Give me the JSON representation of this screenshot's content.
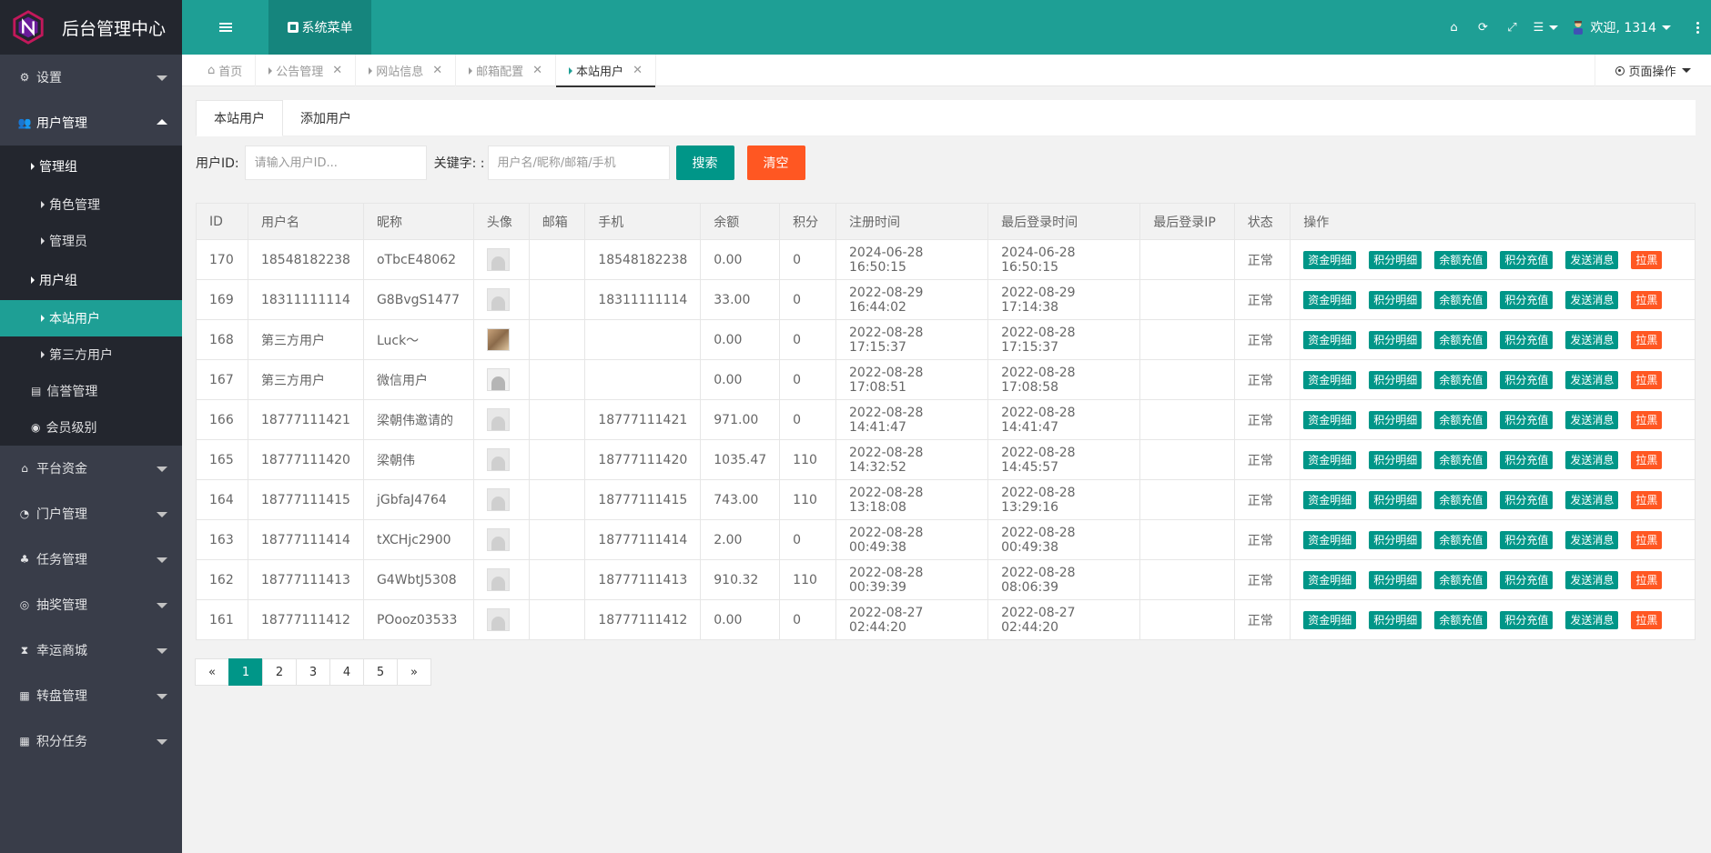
{
  "brand": {
    "title": "后台管理中心"
  },
  "header": {
    "sys_menu": "系统菜单",
    "welcome": "欢迎, 1314"
  },
  "sidebar": {
    "settings": "设置",
    "user_mgmt": "用户管理",
    "admin_group": "管理组",
    "role_mgmt": "角色管理",
    "admins": "管理员",
    "user_group": "用户组",
    "site_users": "本站用户",
    "third_users": "第三方用户",
    "credit_mgmt": "信誉管理",
    "member_level": "会员级别",
    "platform_funds": "平台资金",
    "portal_mgmt": "门户管理",
    "task_mgmt": "任务管理",
    "lottery_mgmt": "抽奖管理",
    "lucky_mall": "幸运商城",
    "wheel_mgmt": "转盘管理",
    "points_task": "积分任务"
  },
  "tabs": [
    {
      "label": "首页",
      "closable": false
    },
    {
      "label": "公告管理",
      "closable": true
    },
    {
      "label": "网站信息",
      "closable": true
    },
    {
      "label": "邮箱配置",
      "closable": true
    },
    {
      "label": "本站用户",
      "closable": true,
      "active": true
    }
  ],
  "page_ops": "页面操作",
  "subtabs": {
    "list": "本站用户",
    "add": "添加用户"
  },
  "search": {
    "uid_label": "用户ID:",
    "uid_placeholder": "请输入用户ID...",
    "kw_label": "关键字: :",
    "kw_placeholder": "用户名/昵称/邮箱/手机",
    "search_btn": "搜索",
    "clear_btn": "清空"
  },
  "table": {
    "columns": [
      "ID",
      "用户名",
      "昵称",
      "头像",
      "邮箱",
      "手机",
      "余额",
      "积分",
      "注册时间",
      "最后登录时间",
      "最后登录IP",
      "状态",
      "操作"
    ],
    "ops": [
      "资金明细",
      "积分明细",
      "余额充值",
      "积分充值",
      "发送消息",
      "拉黑"
    ],
    "rows": [
      {
        "id": "170",
        "username": "18548182238",
        "nickname": "oTbcE48062",
        "avatar": "default",
        "email": "",
        "phone": "18548182238",
        "balance": "0.00",
        "points": "0",
        "reg_time": "2024-06-28 16:50:15",
        "last_login": "2024-06-28 16:50:15",
        "last_ip": "",
        "status": "正常"
      },
      {
        "id": "169",
        "username": "18311111114",
        "nickname": "G8BvgS1477",
        "avatar": "default",
        "email": "",
        "phone": "18311111114",
        "balance": "33.00",
        "points": "0",
        "reg_time": "2022-08-29 16:44:02",
        "last_login": "2022-08-29 17:14:38",
        "last_ip": "",
        "status": "正常"
      },
      {
        "id": "168",
        "username": "第三方用户",
        "nickname": "Luck～",
        "avatar": "photo",
        "email": "",
        "phone": "",
        "balance": "0.00",
        "points": "0",
        "reg_time": "2022-08-28 17:15:37",
        "last_login": "2022-08-28 17:15:37",
        "last_ip": "",
        "status": "正常"
      },
      {
        "id": "167",
        "username": "第三方用户",
        "nickname": "微信用户",
        "avatar": "gray",
        "email": "",
        "phone": "",
        "balance": "0.00",
        "points": "0",
        "reg_time": "2022-08-28 17:08:51",
        "last_login": "2022-08-28 17:08:58",
        "last_ip": "",
        "status": "正常"
      },
      {
        "id": "166",
        "username": "18777111421",
        "nickname": "梁朝伟邀请的",
        "avatar": "default",
        "email": "",
        "phone": "18777111421",
        "balance": "971.00",
        "points": "0",
        "reg_time": "2022-08-28 14:41:47",
        "last_login": "2022-08-28 14:41:47",
        "last_ip": "",
        "status": "正常"
      },
      {
        "id": "165",
        "username": "18777111420",
        "nickname": "梁朝伟",
        "avatar": "default",
        "email": "",
        "phone": "18777111420",
        "balance": "1035.47",
        "points": "110",
        "reg_time": "2022-08-28 14:32:52",
        "last_login": "2022-08-28 14:45:57",
        "last_ip": "",
        "status": "正常"
      },
      {
        "id": "164",
        "username": "18777111415",
        "nickname": "jGbfaJ4764",
        "avatar": "default",
        "email": "",
        "phone": "18777111415",
        "balance": "743.00",
        "points": "110",
        "reg_time": "2022-08-28 13:18:08",
        "last_login": "2022-08-28 13:29:16",
        "last_ip": "",
        "status": "正常"
      },
      {
        "id": "163",
        "username": "18777111414",
        "nickname": "tXCHjc2900",
        "avatar": "default",
        "email": "",
        "phone": "18777111414",
        "balance": "2.00",
        "points": "0",
        "reg_time": "2022-08-28 00:49:38",
        "last_login": "2022-08-28 00:49:38",
        "last_ip": "",
        "status": "正常"
      },
      {
        "id": "162",
        "username": "18777111413",
        "nickname": "G4WbtJ5308",
        "avatar": "default",
        "email": "",
        "phone": "18777111413",
        "balance": "910.32",
        "points": "110",
        "reg_time": "2022-08-28 00:39:39",
        "last_login": "2022-08-28 08:06:39",
        "last_ip": "",
        "status": "正常"
      },
      {
        "id": "161",
        "username": "18777111412",
        "nickname": "POooz03533",
        "avatar": "default",
        "email": "",
        "phone": "18777111412",
        "balance": "0.00",
        "points": "0",
        "reg_time": "2022-08-27 02:44:20",
        "last_login": "2022-08-27 02:44:20",
        "last_ip": "",
        "status": "正常"
      }
    ]
  },
  "pagination": {
    "prev": "«",
    "pages": [
      "1",
      "2",
      "3",
      "4",
      "5"
    ],
    "current": "1",
    "next": "»"
  },
  "colors": {
    "accent": "#1E9F95",
    "primary_btn": "#009688",
    "danger_btn": "#FF5722",
    "sidebar_bg": "#393D49"
  }
}
